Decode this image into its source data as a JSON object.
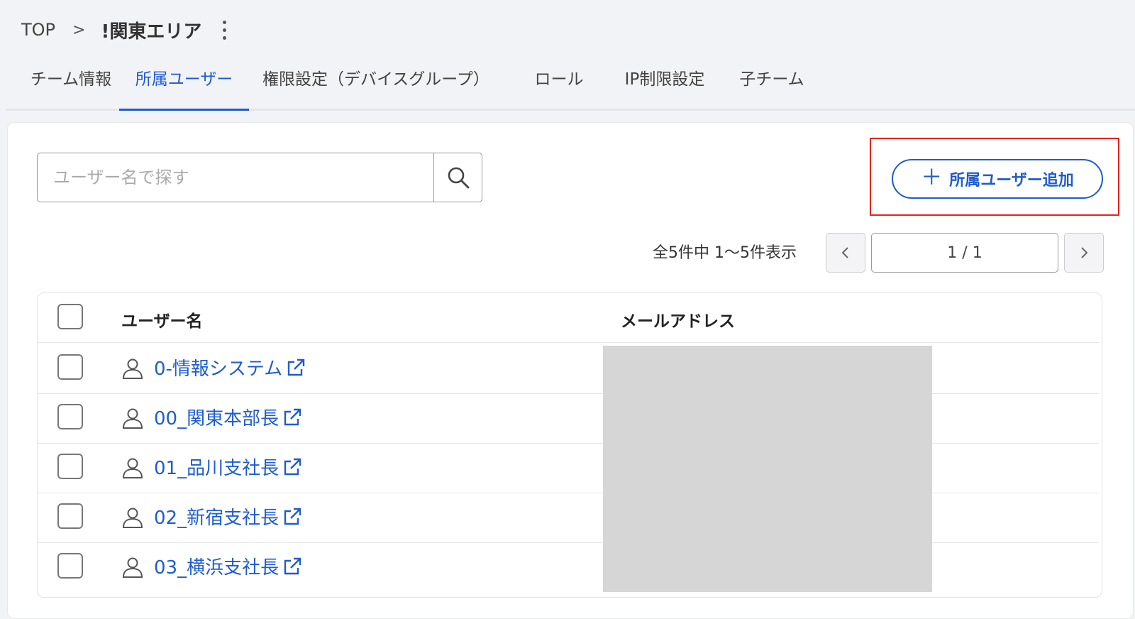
{
  "breadcrumb": {
    "top": "TOP",
    "separator": ">",
    "current": "!関東エリア"
  },
  "tabs": [
    {
      "label": "チーム情報",
      "active": false
    },
    {
      "label": "所属ユーザー",
      "active": true
    },
    {
      "label": "権限設定（デバイスグループ）",
      "active": false
    },
    {
      "label": "ロール",
      "active": false
    },
    {
      "label": "IP制限設定",
      "active": false
    },
    {
      "label": "子チーム",
      "active": false
    }
  ],
  "search": {
    "placeholder": "ユーザー名で探す",
    "value": ""
  },
  "add_button": {
    "label": "所属ユーザー追加"
  },
  "pagination": {
    "summary": "全5件中 1〜5件表示",
    "page": "1 / 1"
  },
  "table": {
    "columns": {
      "name": "ユーザー名",
      "email": "メールアドレス"
    },
    "rows": [
      {
        "name": "0-情報システム"
      },
      {
        "name": "00_関東本部長"
      },
      {
        "name": "01_品川支社長"
      },
      {
        "name": "02_新宿支社長"
      },
      {
        "name": "03_横浜支社長"
      }
    ]
  },
  "colors": {
    "accent": "#1e5ccf",
    "highlight": "#e0241d",
    "background": "#f2f3f7",
    "redacted": "#d6d6d6"
  }
}
